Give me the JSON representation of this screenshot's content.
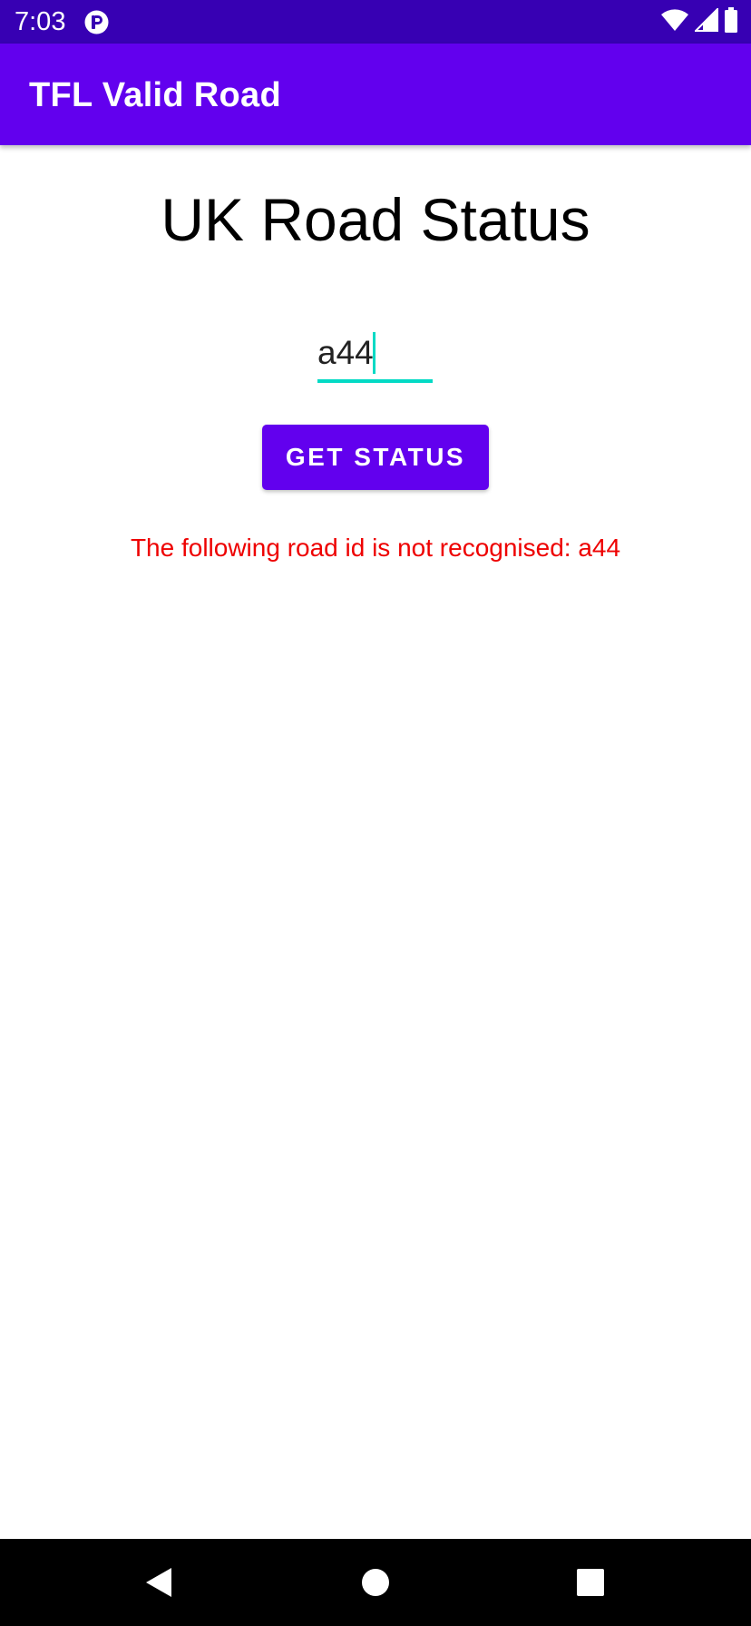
{
  "status_bar": {
    "time": "7:03",
    "notification_icon": "app-notification-icon",
    "icons": [
      "wifi-icon",
      "signal-icon",
      "battery-icon"
    ]
  },
  "app_bar": {
    "title": "TFL Valid Road"
  },
  "main": {
    "heading": "UK Road Status",
    "road_input": {
      "value": "a44",
      "placeholder": ""
    },
    "get_status_label": "GET STATUS",
    "error_message": "The following road id is not recognised: a44"
  },
  "nav_bar": {
    "buttons": [
      "back-icon",
      "home-icon",
      "recents-icon"
    ]
  },
  "colors": {
    "status_bar": "#3700b3",
    "primary": "#6200ee",
    "accent": "#03dac5",
    "error": "#ee0000"
  }
}
